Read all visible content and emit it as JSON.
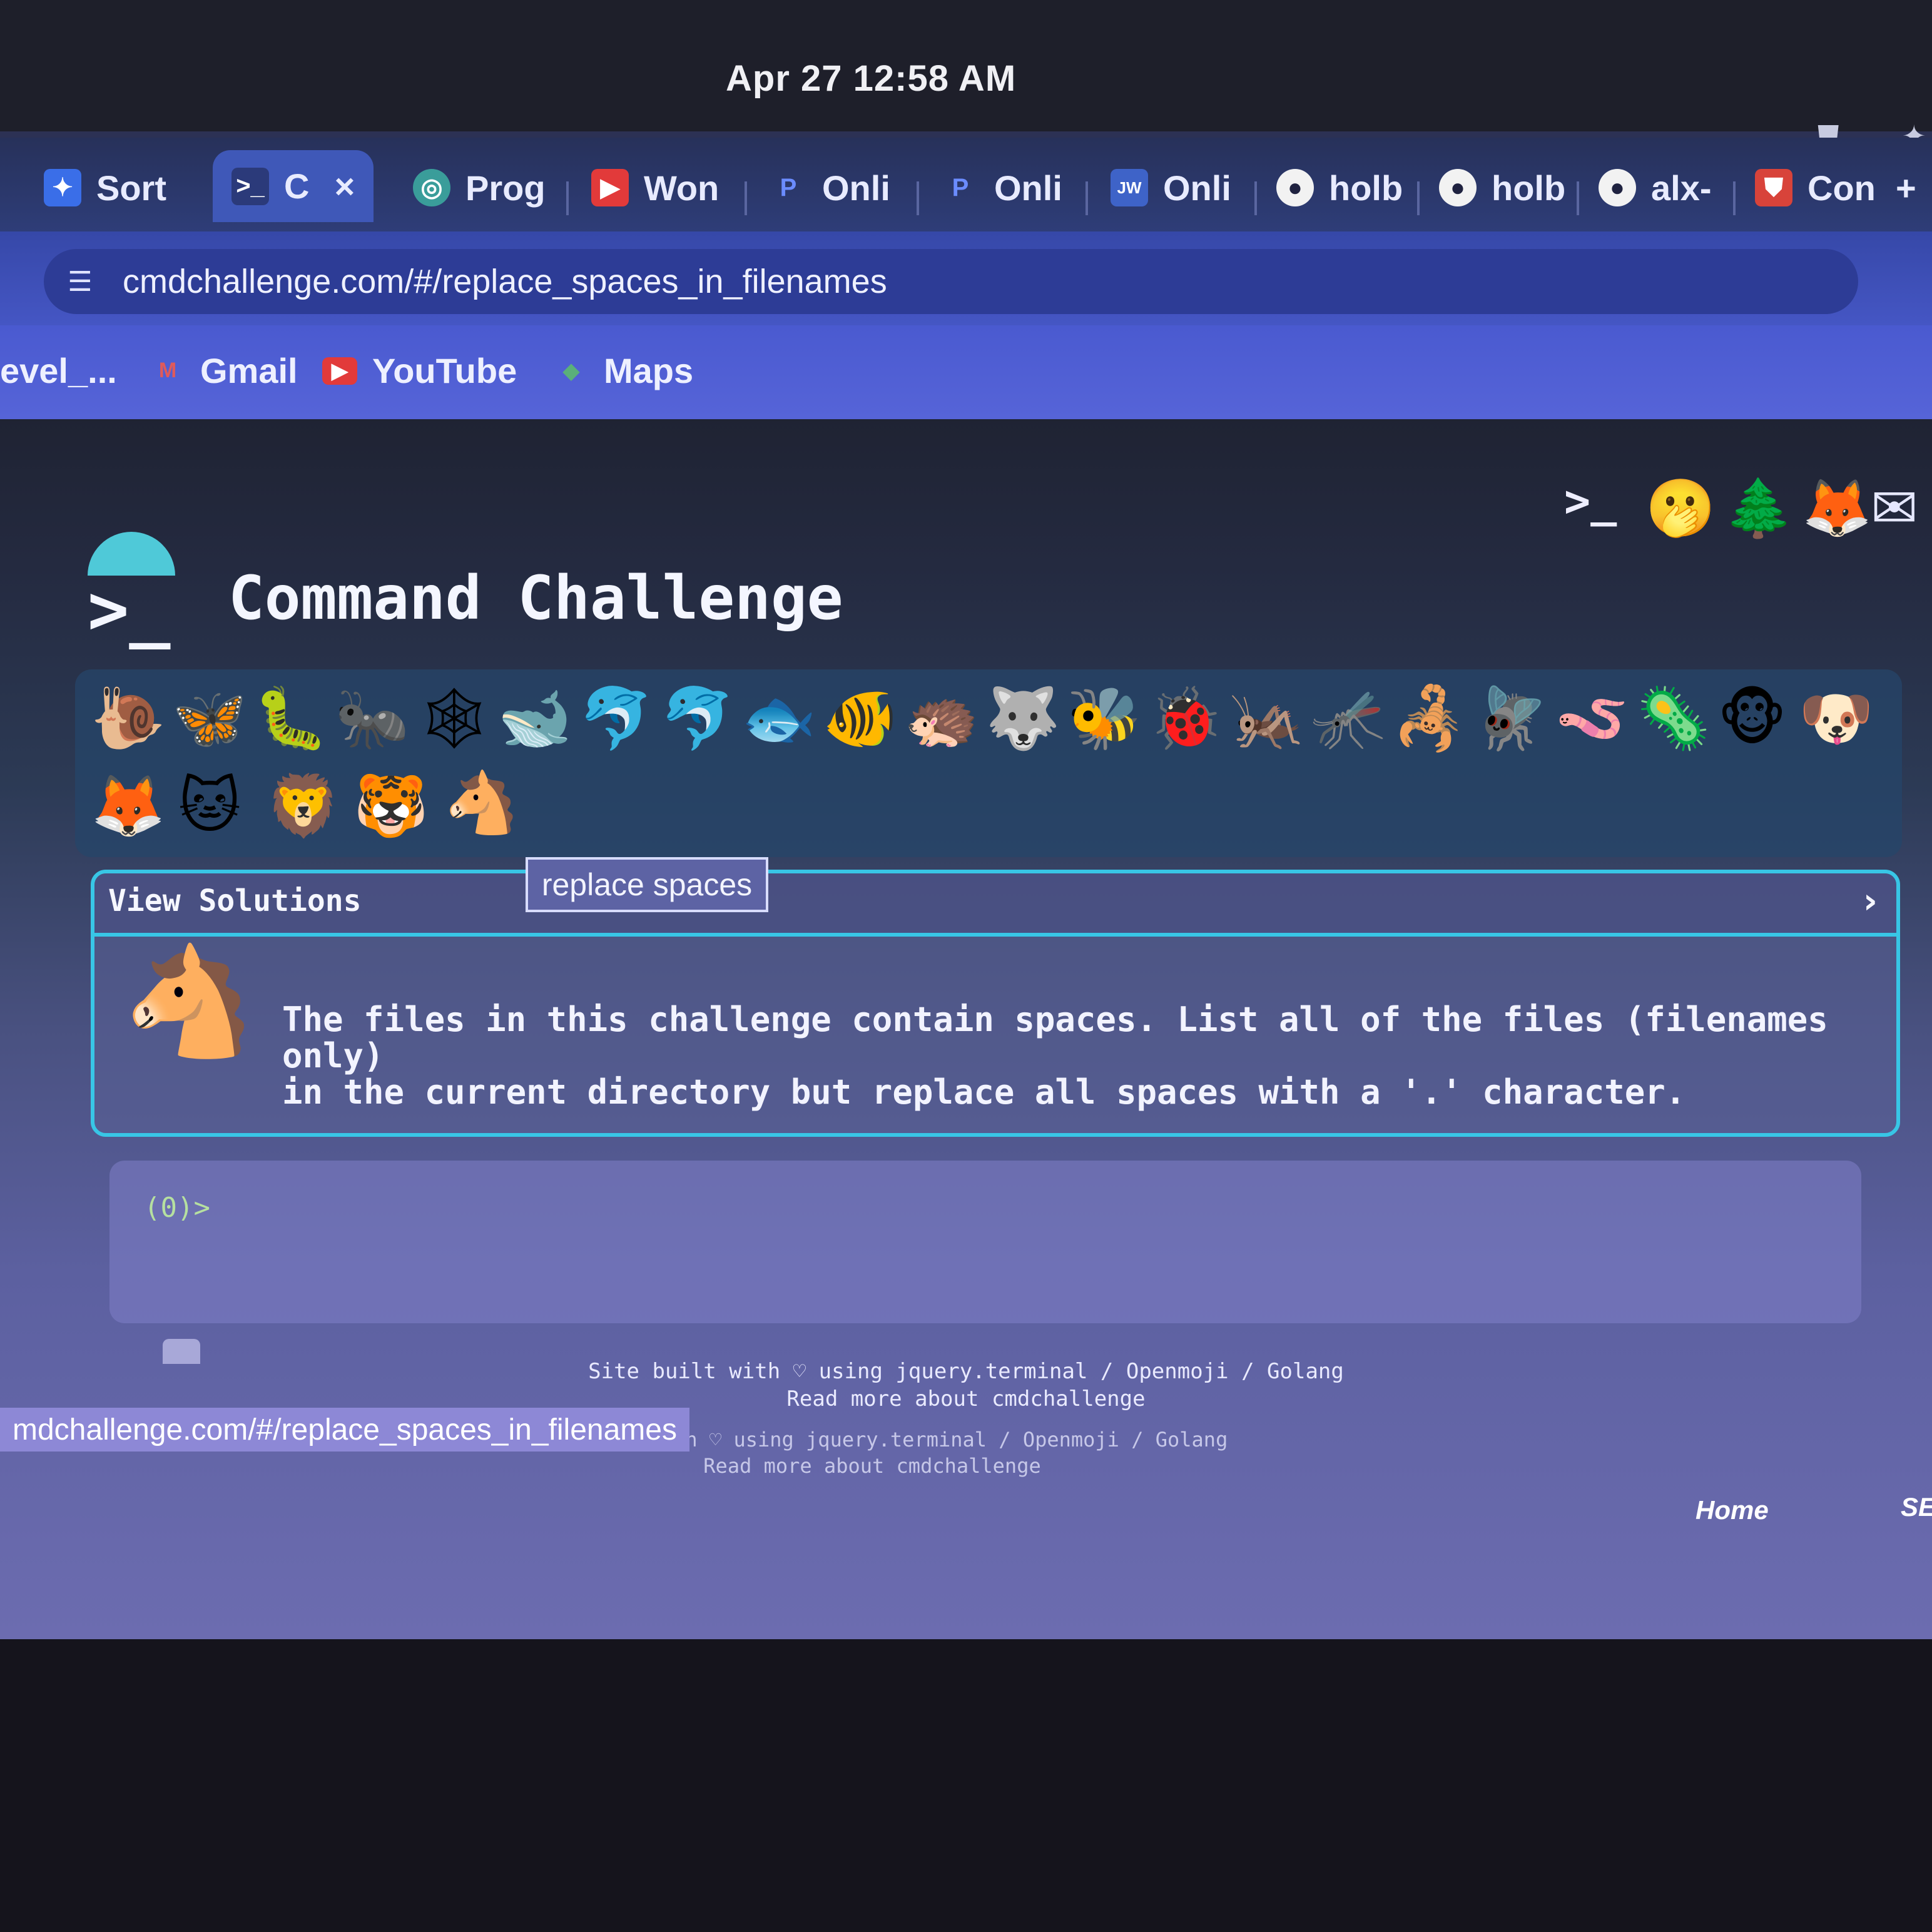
{
  "system": {
    "clock": "Apr 27  12:58 AM"
  },
  "tabs": [
    {
      "label": "Sort",
      "icon": "pin-icon",
      "color": "#3a6ee8",
      "glyph": "✦"
    },
    {
      "label": "C",
      "icon": "terminal-icon",
      "color": "#2b3a7a",
      "glyph": "⌨",
      "active": true,
      "close": "×"
    },
    {
      "label": "Prog",
      "icon": "globe-icon",
      "color": "#3a9d9a",
      "glyph": "◎"
    },
    {
      "label": "Won",
      "icon": "youtube-icon",
      "color": "#e23a3a",
      "glyph": "▶"
    },
    {
      "label": "Onli",
      "icon": "p-icon",
      "color": "#3a5ed8",
      "glyph": "P"
    },
    {
      "label": "Onli",
      "icon": "p-icon",
      "color": "#3a5ed8",
      "glyph": "P"
    },
    {
      "label": "Onli",
      "icon": "jw-icon",
      "color": "#3e63c8",
      "glyph": "JW"
    },
    {
      "label": "holb",
      "icon": "github-icon",
      "color": "#1f2240",
      "glyph": "●"
    },
    {
      "label": "holb",
      "icon": "github-icon",
      "color": "#1f2240",
      "glyph": "●"
    },
    {
      "label": "alx-",
      "icon": "github-icon",
      "color": "#1f2240",
      "glyph": "●"
    },
    {
      "label": "Con",
      "icon": "shield-icon",
      "color": "#d8433a",
      "glyph": "⛊"
    }
  ],
  "new_tab": "+",
  "address": {
    "url": "cmdchallenge.com/#/replace_spaces_in_filenames"
  },
  "bookmarks": [
    {
      "label": "evel_...",
      "icon": ""
    },
    {
      "label": "Gmail",
      "icon": "gmail-icon",
      "color": "#d94b4b",
      "glyph": "M"
    },
    {
      "label": "YouTube",
      "icon": "youtube-icon",
      "color": "#e23a3a",
      "glyph": "▶"
    },
    {
      "label": "Maps",
      "icon": "maps-icon",
      "color": "#4a9a6a",
      "glyph": "◆"
    }
  ],
  "header": {
    "logo_glyph": ">_",
    "title": "Command Challenge",
    "social": [
      {
        "name": "terminal-link-icon",
        "glyph": ">_"
      },
      {
        "name": "face-emoji-icon",
        "glyph": "🫢"
      },
      {
        "name": "tree-icon",
        "glyph": "🌲"
      },
      {
        "name": "gitlab-icon",
        "glyph": "🦊"
      },
      {
        "name": "mail-icon",
        "glyph": "✉"
      }
    ]
  },
  "challenges": {
    "row1": [
      "🐌",
      "🦋",
      "🐛",
      "🐜",
      "🕸",
      "🐋",
      "🐬",
      "🐬",
      "🐟",
      "🐠",
      "🦔",
      "🐺",
      "🐝",
      "🐞",
      "🦗",
      "🦟",
      "🦂",
      "🪰",
      "🪱",
      "🦠",
      "🐵",
      "🐶"
    ],
    "row2": [
      "🦊",
      "🐱",
      "🦁",
      "🐯",
      "🐴"
    ]
  },
  "tooltip": "replace spaces",
  "solutions": {
    "title": "View Solutions",
    "chevron": "›",
    "horse": "🐴",
    "description": "The files in this challenge contain spaces. List all of the files (filenames only)\nin the current directory but replace all spaces with a '.' character."
  },
  "terminal": {
    "prompt": "(0)>"
  },
  "footer": {
    "line1": "Site built with ♡ using jquery.terminal / Openmoji / Golang",
    "line2": "Read more about cmdchallenge",
    "line1_dup": "Site built with ♡ using jquery.terminal / Openmoji / Golang",
    "line2_dup": "Read more about cmdchallenge"
  },
  "statusbar": {
    "url": "mdchallenge.com/#/replace_spaces_in_filenames"
  },
  "taskbar": {
    "home": "Home",
    "se": "SE"
  }
}
